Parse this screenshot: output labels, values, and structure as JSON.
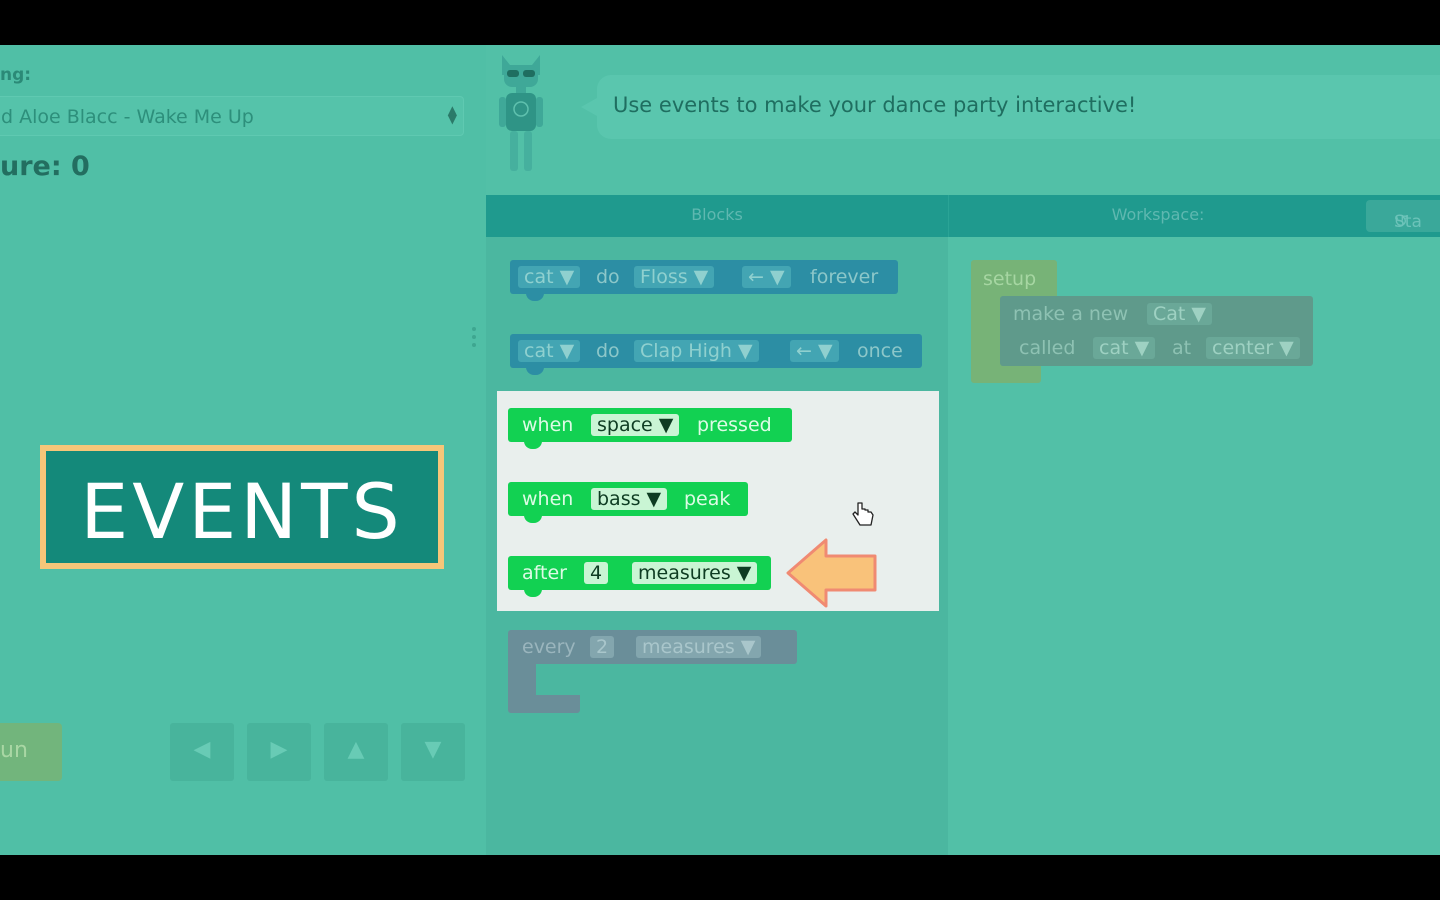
{
  "left": {
    "song_label": "ng:",
    "song_value": "d Aloe Blacc - Wake Me Up",
    "score": "ure: 0",
    "events_title": "EVENTS",
    "run_label": "un",
    "arrows": [
      "◀",
      "▶",
      "▲",
      "▼"
    ]
  },
  "instructions": {
    "text": "Use events to make your dance party interactive!"
  },
  "headers": {
    "blocks": "Blocks",
    "workspace": "Workspace:",
    "start_over": "Sta"
  },
  "toolbox": {
    "block1": {
      "sprite": "cat ▼",
      "do": "do",
      "move": "Floss ▼",
      "dir": "← ▼",
      "tail": "forever"
    },
    "block2": {
      "sprite": "cat ▼",
      "do": "do",
      "move": "Clap High ▼",
      "dir": "← ▼",
      "tail": "once"
    },
    "block3": {
      "when": "when",
      "key": "space ▼",
      "tail": "pressed"
    },
    "block4": {
      "when": "when",
      "key": "bass ▼",
      "tail": "peak"
    },
    "block5": {
      "after": "after",
      "num": "4",
      "unit": "measures ▼"
    },
    "block6": {
      "every": "every",
      "num": "2",
      "unit": "measures ▼"
    }
  },
  "workspace": {
    "setup": "setup",
    "make_new": "make a new",
    "cat_type": "Cat ▼",
    "called": "called",
    "cat_name": "cat ▼",
    "at": "at",
    "location": "center ▼"
  },
  "colors": {
    "event_green": "#12d152",
    "highlight_bg": "#e9efed",
    "events_badge": "#14897a",
    "badge_border": "#f6c679",
    "arrow": "#f9c27a"
  }
}
